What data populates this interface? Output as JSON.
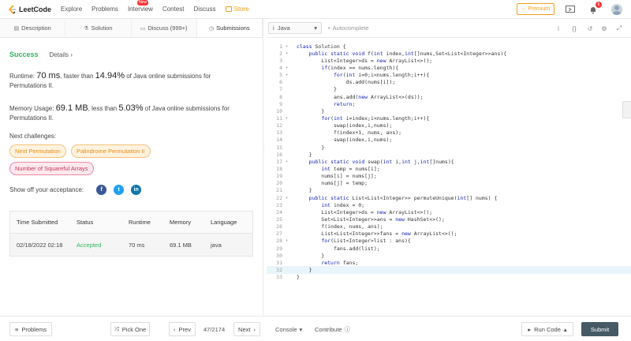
{
  "nav": {
    "brand": "LeetCode",
    "items": [
      "Explore",
      "Problems",
      "Interview",
      "Contest",
      "Discuss"
    ],
    "new_badge": "New",
    "store": "Store",
    "premium": "Premium",
    "notification_count": "6",
    "store_color": "#f0a020"
  },
  "tabs": [
    {
      "label": "Description",
      "icon": "document-icon"
    },
    {
      "label": "Solution",
      "icon": "flask-icon"
    },
    {
      "label": "Discuss (999+)",
      "icon": "chat-icon"
    },
    {
      "label": "Submissions",
      "icon": "clock-icon"
    }
  ],
  "result": {
    "status": "Success",
    "details": "Details",
    "runtime_prefix": "Runtime: ",
    "runtime_value": "70 ms",
    "runtime_mid": ", faster than ",
    "runtime_percent": "14.94%",
    "runtime_suffix": " of Java online submissions for Permutations II.",
    "memory_prefix": "Memory Usage: ",
    "memory_value": "69.1 MB",
    "memory_mid": ", less than ",
    "memory_percent": "5.03%",
    "memory_suffix": " of Java online submissions for Permutations II.",
    "next_label": "Next challenges:",
    "challenges": [
      {
        "label": "Next Permutation",
        "difficulty": "medium"
      },
      {
        "label": "Palindrome Permutation II",
        "difficulty": "medium"
      },
      {
        "label": "Number of Squareful Arrays",
        "difficulty": "hard"
      }
    ],
    "share_label": "Show off your acceptance:",
    "success_color": "#2db55d"
  },
  "submissions": {
    "headers": [
      "Time Submitted",
      "Status",
      "Runtime",
      "Memory",
      "Language"
    ],
    "rows": [
      [
        "02/18/2022 02:18",
        "Accepted",
        "70 ms",
        "69.1 MB",
        "java"
      ]
    ]
  },
  "editor": {
    "language": "Java",
    "autocomplete": "Autocomplete",
    "active_line": 32,
    "lines": [
      "class Solution {",
      "    public static void f(int index,int[]nums,Set<List<Integer>>ans){",
      "        List<Integer>ds = new ArrayList<>();",
      "        if(index == nums.length){",
      "            for(int i=0;i<nums.length;i++){",
      "                ds.add(nums[i]);",
      "            }",
      "            ans.add(new ArrayList<>(ds));",
      "            return;",
      "        }",
      "        for(int i=index;i<nums.length;i++){",
      "            swap(index,i,nums);",
      "            f(index+1, nums, ans);",
      "            swap(index,i,nums);",
      "        }",
      "    }",
      "    public static void swap(int i,int j,int[]nums){",
      "        int temp = nums[i];",
      "        nums[i] = nums[j];",
      "        nums[j] = temp;",
      "    }",
      "    public static List<List<Integer>> permuteUnique(int[] nums) {",
      "        int index = 0;",
      "        List<Integer>ds = new ArrayList<>();",
      "        Set<List<Integer>>ans = new HashSet<>();",
      "        f(index, nums, ans);",
      "        List<List<Integer>>fans = new ArrayList<>();",
      "        for(List<Integer>list : ans){",
      "            fans.add(list);",
      "        }",
      "        return fans;",
      "    }",
      "}"
    ],
    "foldable": [
      1,
      2,
      4,
      5,
      11,
      17,
      22,
      28
    ]
  },
  "bottom": {
    "problems": "Problems",
    "pick_one": "Pick One",
    "prev": "Prev",
    "page": "47/2174",
    "next": "Next",
    "console": "Console",
    "contribute": "Contribute",
    "run_code": "Run Code",
    "submit": "Submit"
  }
}
